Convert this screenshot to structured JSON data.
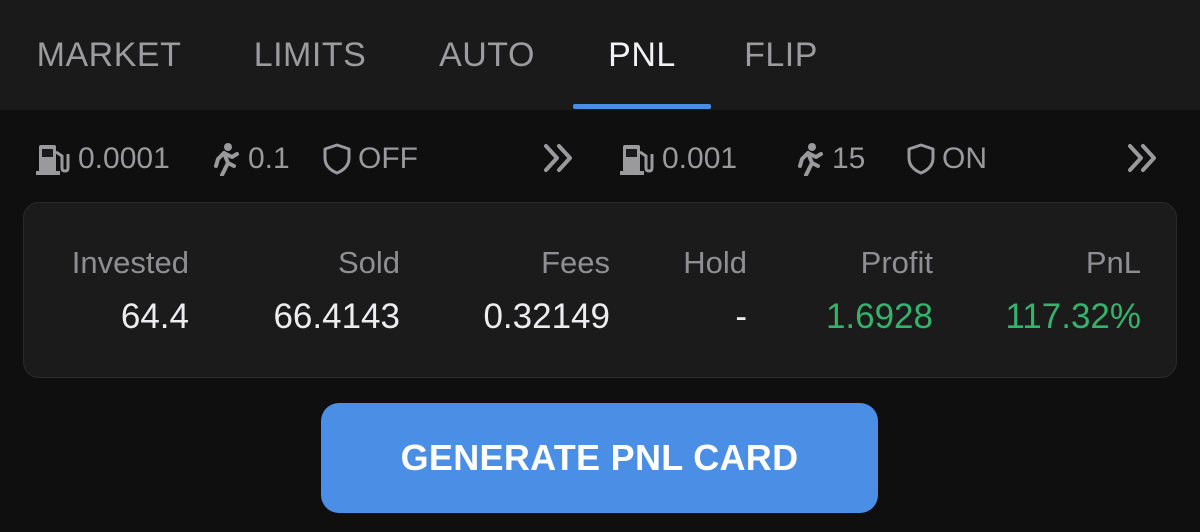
{
  "tabs": [
    {
      "label": "MARKET"
    },
    {
      "label": "LIMITS"
    },
    {
      "label": "AUTO"
    },
    {
      "label": "PNL",
      "active": true
    },
    {
      "label": "FLIP"
    }
  ],
  "buy_settings": {
    "gas": "0.0001",
    "slippage": "0.1",
    "protection": "OFF"
  },
  "sell_settings": {
    "gas": "0.001",
    "slippage": "15",
    "protection": "ON"
  },
  "stats": {
    "headers": {
      "invested": "Invested",
      "sold": "Sold",
      "fees": "Fees",
      "hold": "Hold",
      "profit": "Profit",
      "pnl": "PnL"
    },
    "values": {
      "invested": "64.4",
      "sold": "66.4143",
      "fees": "0.32149",
      "hold": "-",
      "profit": "1.6928",
      "pnl": "117.32%"
    }
  },
  "generate_button": "GENERATE PNL CARD",
  "colors": {
    "accent": "#4a8ee6",
    "profit_green": "#35b26b"
  },
  "icons": {
    "gas": "gas-pump-icon",
    "slippage": "walking-person-icon",
    "protection": "shield-icon",
    "expand": "double-chevron-right-icon"
  }
}
